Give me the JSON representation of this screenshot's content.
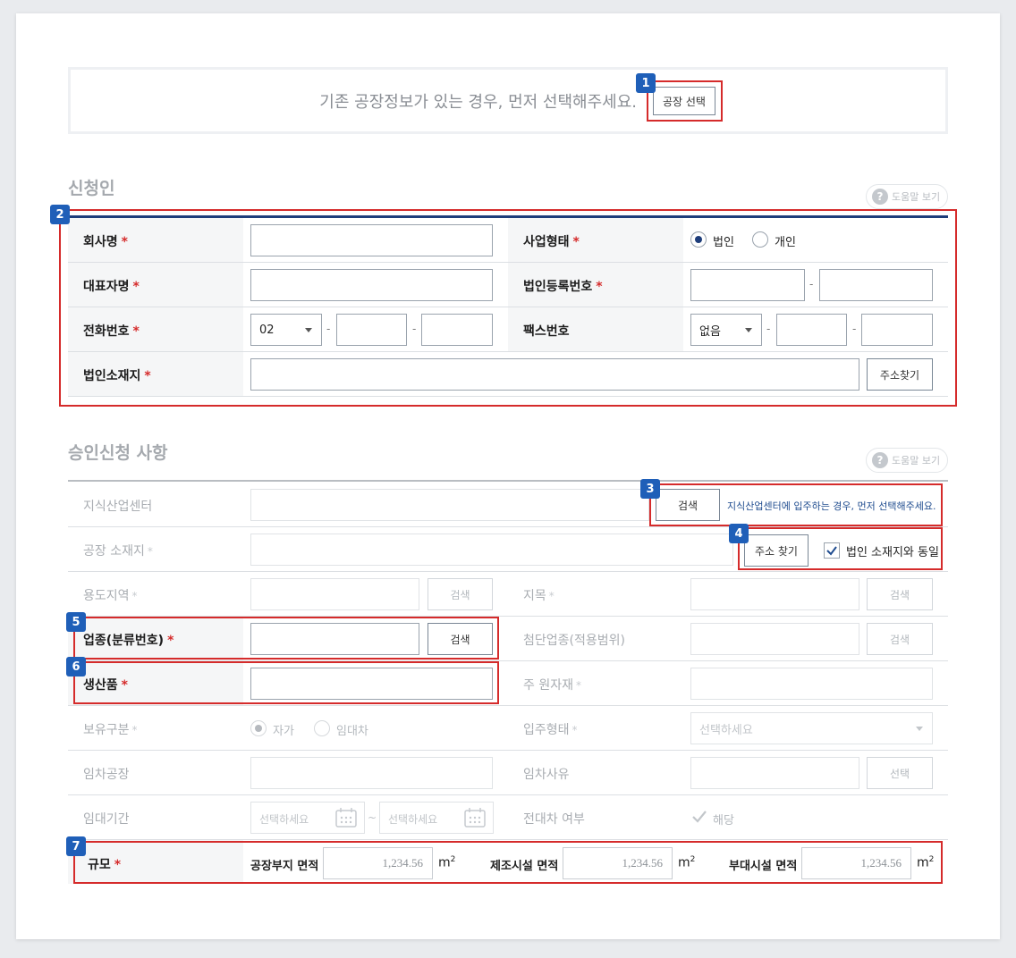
{
  "notice": {
    "text": "기존 공장정보가 있는 경우, 먼저 선택해주세요.",
    "button": "공장 선택"
  },
  "badges": [
    "1",
    "2",
    "3",
    "4",
    "5",
    "6",
    "7"
  ],
  "help_label": "도움말 보기",
  "applicant": {
    "title": "신청인",
    "company_name": "회사명",
    "business_type": "사업형태",
    "business_type_options": [
      "법인",
      "개인"
    ],
    "representative": "대표자명",
    "corp_reg_no": "법인등록번호",
    "phone": "전화번호",
    "phone_area": "02",
    "fax": "팩스번호",
    "fax_area": "없음",
    "address": "법인소재지",
    "address_button": "주소찾기",
    "required_mark": "*",
    "dash": "-"
  },
  "approval": {
    "title": "승인신청 사항",
    "knowledge_center": "지식산업센터",
    "search_button": "검색",
    "knowledge_note": "지식산업센터에 입주하는 경우, 먼저 선택해주세요.",
    "factory_address": "공장 소재지",
    "address_button": "주소 찾기",
    "same_as_corp": "법인 소재지와 동일",
    "zoning": "용도지역",
    "land_category": "지목",
    "industry": "업종(분류번호)",
    "advanced_industry": "첨단업종(적용범위)",
    "product": "생산품",
    "raw_material": "주 원자재",
    "ownership": "보유구분",
    "ownership_options": [
      "자가",
      "임대차"
    ],
    "tenancy_type": "입주형태",
    "tenancy_placeholder": "선택하세요",
    "lease_factory": "임차공장",
    "lease_reason": "임차사유",
    "select_button": "선택",
    "lease_period": "임대기간",
    "date_placeholder": "선택하세요",
    "tilde": "~",
    "sublease": "전대차 여부",
    "sublease_check": "해당",
    "scale": "규모",
    "site_area": "공장부지 면적",
    "site_area_value": "1,234.56",
    "mfg_area": "제조시설 면적",
    "mfg_area_value": "1,234.56",
    "aux_area": "부대시설 면적",
    "aux_area_value": "1,234.56",
    "unit": "m",
    "unit_sup": "2",
    "required_mark": "*"
  }
}
